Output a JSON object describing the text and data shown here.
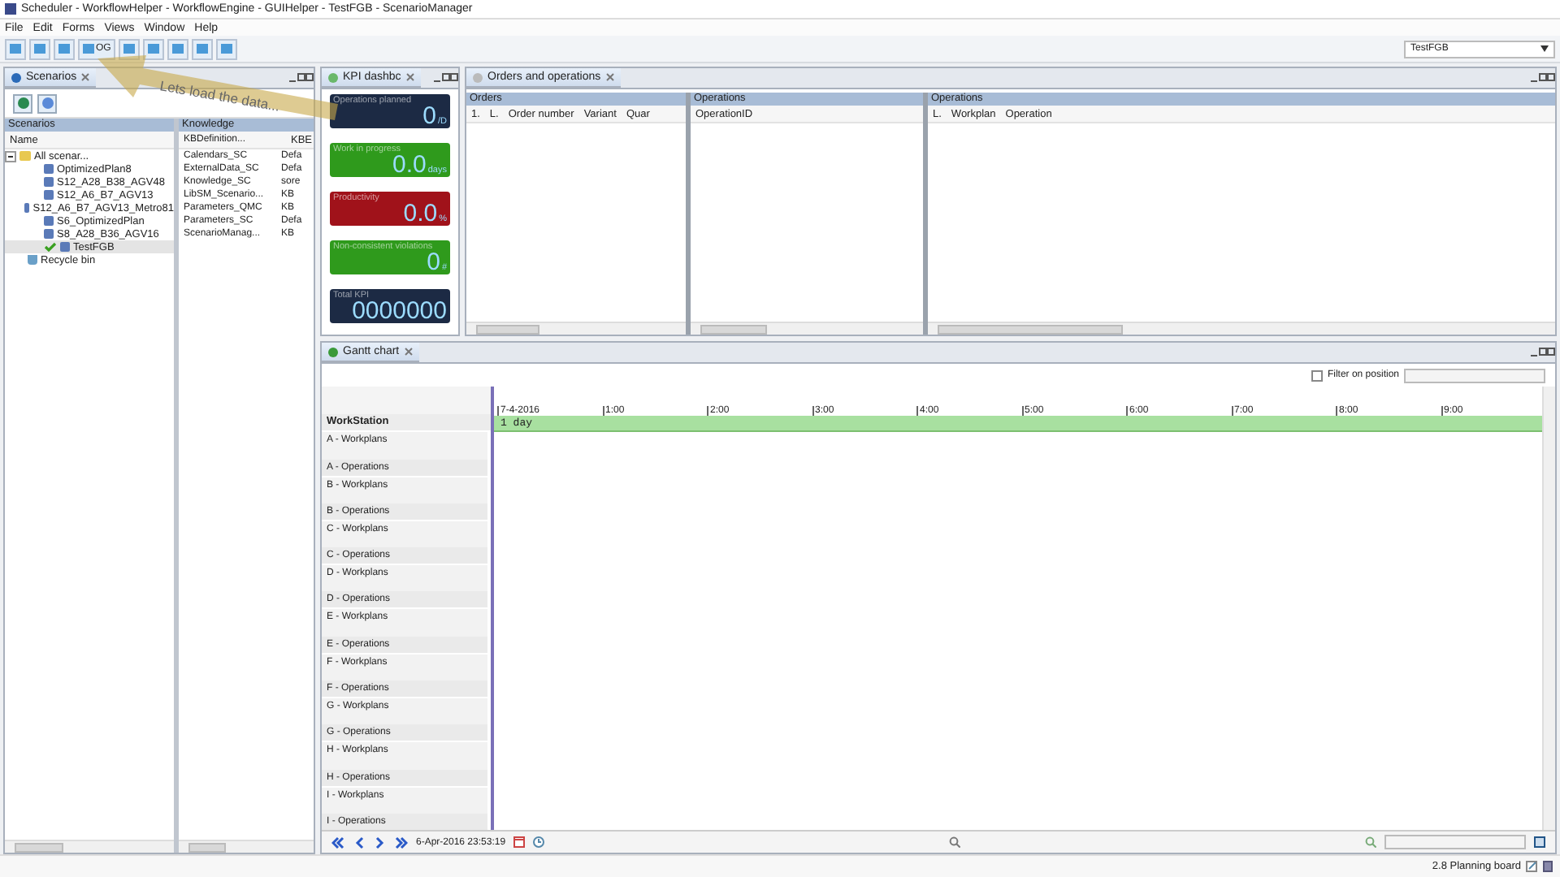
{
  "window": {
    "title": "Scheduler - WorkflowHelper - WorkflowEngine - GUIHelper - TestFGB - ScenarioManager"
  },
  "menu": [
    "File",
    "Edit",
    "Forms",
    "Views",
    "Window",
    "Help"
  ],
  "toolbar": {
    "button_label": "OG",
    "combo_value": "TestFGB"
  },
  "callout": {
    "text": "Lets load the data..."
  },
  "scenarios_view": {
    "title": "Scenarios",
    "tree_panel": {
      "title": "Scenarios",
      "column": "Name",
      "tree": [
        {
          "label": "All scenar...",
          "expanded": true,
          "kind": "folder",
          "selected": false,
          "children": [
            {
              "label": "OptimizedPlan8",
              "kind": "scenario",
              "selected": false,
              "active": false
            },
            {
              "label": "S12_A28_B38_AGV48",
              "kind": "scenario",
              "selected": false,
              "active": false
            },
            {
              "label": "S12_A6_B7_AGV13",
              "kind": "scenario",
              "selected": false,
              "active": false
            },
            {
              "label": "S12_A6_B7_AGV13_Metro81",
              "kind": "scenario",
              "selected": false,
              "active": false
            },
            {
              "label": "S6_OptimizedPlan",
              "kind": "scenario",
              "selected": false,
              "active": false
            },
            {
              "label": "S8_A28_B36_AGV16",
              "kind": "scenario",
              "selected": false,
              "active": false
            },
            {
              "label": "TestFGB",
              "kind": "scenario",
              "selected": true,
              "active": true
            }
          ]
        },
        {
          "label": "Recycle bin",
          "kind": "bin",
          "selected": false
        }
      ]
    },
    "knowledge_panel": {
      "title": "Knowledge",
      "columns": [
        "KBDefinition...",
        "KBE"
      ],
      "rows": [
        [
          "Calendars_SC",
          "Defa"
        ],
        [
          "ExternalData_SC",
          "Defa"
        ],
        [
          "Knowledge_SC",
          "sore"
        ],
        [
          "LibSM_Scenario...",
          "KB"
        ],
        [
          "Parameters_QMC",
          "KB"
        ],
        [
          "Parameters_SC",
          "Defa"
        ],
        [
          "ScenarioManag...",
          "KB"
        ]
      ]
    }
  },
  "kpi_dashboard": {
    "title": "KPI dashbc",
    "tiles": [
      {
        "label": "Operations planned",
        "value": "0",
        "unit": "/D",
        "color": "#1c2a44"
      },
      {
        "label": "Work in progress",
        "value": "0.0",
        "unit": "days",
        "color": "#2f9a1c"
      },
      {
        "label": "Productivity",
        "value": "0.0",
        "unit": "%",
        "color": "#a0121a"
      },
      {
        "label": "Non-consistent violations",
        "value": "0",
        "unit": "#",
        "color": "#2f9a1c"
      },
      {
        "label": "Total KPI",
        "value": "0000000",
        "color": "#1c2a44"
      }
    ]
  },
  "orders_view": {
    "title": "Orders and operations",
    "panels": [
      {
        "title": "Orders",
        "columns": [
          "1.",
          "L.",
          "Order number",
          "Variant",
          "Quar"
        ]
      },
      {
        "title": "Operations",
        "columns": [
          "OperationID"
        ]
      },
      {
        "title": "Operations",
        "columns": [
          "L.",
          "Workplan",
          "Operation"
        ]
      }
    ]
  },
  "gantt": {
    "title": "Gantt chart",
    "filter": {
      "label": "Filter on position",
      "checked": false
    },
    "header": "WorkStation",
    "ticks": [
      "7-4-2016",
      "1:00",
      "2:00",
      "3:00",
      "4:00",
      "5:00",
      "6:00",
      "7:00",
      "8:00",
      "9:00"
    ],
    "bar_label": "1 day",
    "rows": [
      {
        "label": "A - Workplans",
        "kind": "workplans"
      },
      {
        "label": "A - Operations",
        "kind": "operations"
      },
      {
        "label": "B - Workplans",
        "kind": "workplans"
      },
      {
        "label": "B - Operations",
        "kind": "operations"
      },
      {
        "label": "C - Workplans",
        "kind": "workplans"
      },
      {
        "label": "C - Operations",
        "kind": "operations"
      },
      {
        "label": "D - Workplans",
        "kind": "workplans"
      },
      {
        "label": "D - Operations",
        "kind": "operations"
      },
      {
        "label": "E - Workplans",
        "kind": "workplans"
      },
      {
        "label": "E - Operations",
        "kind": "operations"
      },
      {
        "label": "F - Workplans",
        "kind": "workplans"
      },
      {
        "label": "F - Operations",
        "kind": "operations"
      },
      {
        "label": "G - Workplans",
        "kind": "workplans"
      },
      {
        "label": "G - Operations",
        "kind": "operations"
      },
      {
        "label": "H - Workplans",
        "kind": "workplans"
      },
      {
        "label": "H - Operations",
        "kind": "operations"
      },
      {
        "label": "I - Workplans",
        "kind": "workplans"
      },
      {
        "label": "I - Operations",
        "kind": "operations"
      }
    ],
    "date": "6-Apr-2016 23:53:19"
  },
  "status_bar": {
    "text": "2.8 Planning board"
  }
}
